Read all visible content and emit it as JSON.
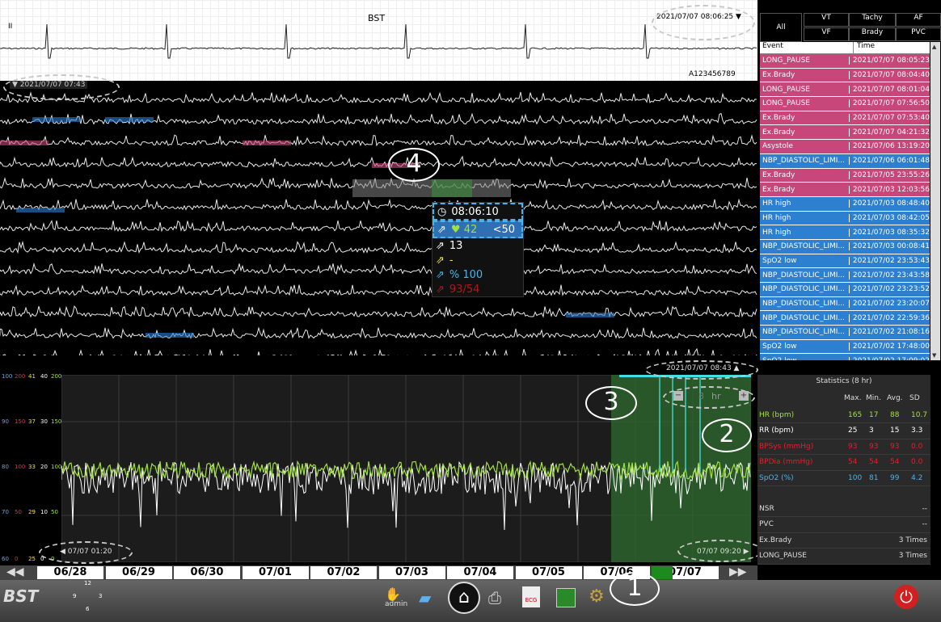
{
  "strip": {
    "lead": "II",
    "title": "BST",
    "timestamp": "2021/07/07 08:06:25 ▼",
    "patient_id": "A123456789"
  },
  "compressed": {
    "start": "▼ 2021/07/07 07:43"
  },
  "popup": {
    "time": "08:06:10",
    "hr": "♥ 42",
    "hr_flag": "<50",
    "rr": "13",
    "st": "-",
    "spo2": "% 100",
    "bp": "93/54"
  },
  "filters": {
    "all": "All",
    "vt": "VT",
    "tachy": "Tachy",
    "af": "AF",
    "vf": "VF",
    "brady": "Brady",
    "pvc": "PVC"
  },
  "events": {
    "headers": {
      "event": "Event",
      "time": "Time"
    },
    "rows": [
      {
        "event": "LONG_PAUSE",
        "time": "2021/07/07 08:05:23",
        "color": "#c8477a"
      },
      {
        "event": "Ex.Brady",
        "time": "2021/07/07 08:04:40",
        "color": "#c8477a"
      },
      {
        "event": "LONG_PAUSE",
        "time": "2021/07/07 08:01:04",
        "color": "#c8477a"
      },
      {
        "event": "LONG_PAUSE",
        "time": "2021/07/07 07:56:50",
        "color": "#c8477a"
      },
      {
        "event": "Ex.Brady",
        "time": "2021/07/07 07:53:40",
        "color": "#c8477a"
      },
      {
        "event": "Ex.Brady",
        "time": "2021/07/07 04:21:32",
        "color": "#c8477a"
      },
      {
        "event": "Asystole",
        "time": "2021/07/06 13:19:20",
        "color": "#c8477a"
      },
      {
        "event": "NBP_DIASTOLIC_LIMI...",
        "time": "2021/07/06 06:01:48",
        "color": "#2d7fd0"
      },
      {
        "event": "Ex.Brady",
        "time": "2021/07/05 23:55:26",
        "color": "#c8477a"
      },
      {
        "event": "Ex.Brady",
        "time": "2021/07/03 12:03:56",
        "color": "#c8477a"
      },
      {
        "event": "HR high",
        "time": "2021/07/03 08:48:40",
        "color": "#2d7fd0"
      },
      {
        "event": "HR high",
        "time": "2021/07/03 08:42:05",
        "color": "#2d7fd0"
      },
      {
        "event": "HR high",
        "time": "2021/07/03 08:35:32",
        "color": "#2d7fd0"
      },
      {
        "event": "NBP_DIASTOLIC_LIMI...",
        "time": "2021/07/03 00:08:41",
        "color": "#2d7fd0"
      },
      {
        "event": "SpO2 low",
        "time": "2021/07/02 23:53:43",
        "color": "#2d7fd0"
      },
      {
        "event": "NBP_DIASTOLIC_LIMI...",
        "time": "2021/07/02 23:43:58",
        "color": "#2d7fd0"
      },
      {
        "event": "NBP_DIASTOLIC_LIMI...",
        "time": "2021/07/02 23:23:52",
        "color": "#2d7fd0"
      },
      {
        "event": "NBP_DIASTOLIC_LIMI...",
        "time": "2021/07/02 23:20:07",
        "color": "#2d7fd0"
      },
      {
        "event": "NBP_DIASTOLIC_LIMI...",
        "time": "2021/07/02 22:59:36",
        "color": "#2d7fd0"
      },
      {
        "event": "NBP_DIASTOLIC_LIMI...",
        "time": "2021/07/02 21:08:16",
        "color": "#2d7fd0"
      },
      {
        "event": "SpO2 low",
        "time": "2021/07/02 17:48:00",
        "color": "#2d7fd0"
      },
      {
        "event": "SpO2 low",
        "time": "2021/07/02 17:09:02",
        "color": "#2d7fd0"
      },
      {
        "event": "SpO2 low",
        "time": "2021/07/02 17:06:37",
        "color": "#2d7fd0"
      }
    ]
  },
  "trend": {
    "axis_cols": [
      {
        "color": "#46b4f0",
        "ticks": [
          "100",
          "90",
          "80",
          "70",
          "60"
        ]
      },
      {
        "color": "#e0304a",
        "ticks": [
          "200",
          "150",
          "100",
          "50",
          "0"
        ]
      },
      {
        "color": "#f0e040",
        "ticks": [
          "41",
          "37",
          "33",
          "29",
          "25"
        ]
      },
      {
        "color": "#ffffff",
        "ticks": [
          "40",
          "30",
          "20",
          "10",
          "0"
        ]
      },
      {
        "color": "#a0e040",
        "ticks": [
          "200",
          "150",
          "100",
          "50",
          "0"
        ]
      }
    ],
    "start": "◀ 07/07 01:20",
    "end": "07/07 09:20 ▶",
    "marker": "2021/07/07 08:43 ▲",
    "zoom_unit": "hr",
    "zoom_value": "8",
    "minus": "−",
    "plus": "+"
  },
  "dates": [
    "06/28",
    "06/29",
    "06/30",
    "07/01",
    "07/02",
    "07/03",
    "07/04",
    "07/05",
    "07/06",
    "07/07"
  ],
  "nav": {
    "prev": "◀◀",
    "next": "▶▶"
  },
  "stats": {
    "title": "Statistics (8 hr)",
    "headers": [
      "Max.",
      "Min.",
      "Avg.",
      "SD"
    ],
    "rows": [
      {
        "label": "HR (bpm)",
        "color": "#a0e040",
        "max": "165",
        "min": "17",
        "avg": "88",
        "sd": "10.7"
      },
      {
        "label": "RR (bpm)",
        "color": "#ffffff",
        "max": "25",
        "min": "3",
        "avg": "15",
        "sd": "3.3"
      },
      {
        "label": "BPSys (mmHg)",
        "color": "#e0202a",
        "max": "93",
        "min": "93",
        "avg": "93",
        "sd": "0.0"
      },
      {
        "label": "BPDia (mmHg)",
        "color": "#e0202a",
        "max": "54",
        "min": "54",
        "avg": "54",
        "sd": "0.0"
      },
      {
        "label": "SpO2 (%)",
        "color": "#46b4f0",
        "max": "100",
        "min": "81",
        "avg": "99",
        "sd": "4.2"
      }
    ],
    "rhythm": [
      {
        "label": "NSR",
        "value": "--"
      },
      {
        "label": "PVC",
        "value": "--"
      },
      {
        "label": "Ex.Brady",
        "value": "3 Times"
      },
      {
        "label": "LONG_PAUSE",
        "value": "3 Times"
      }
    ]
  },
  "toolbar": {
    "admin": "admin",
    "logo": "BST",
    "clock": [
      "12",
      "9",
      "3",
      "6"
    ],
    "ecg_label": "ECG"
  },
  "callouts": [
    "1",
    "2",
    "3",
    "4"
  ],
  "colors": {
    "ecg": "#ffffff",
    "hr_trend": "#a0e040",
    "pause": "#c8477a",
    "alarm": "#2d7fd0",
    "selection": "#2e6b2e"
  }
}
